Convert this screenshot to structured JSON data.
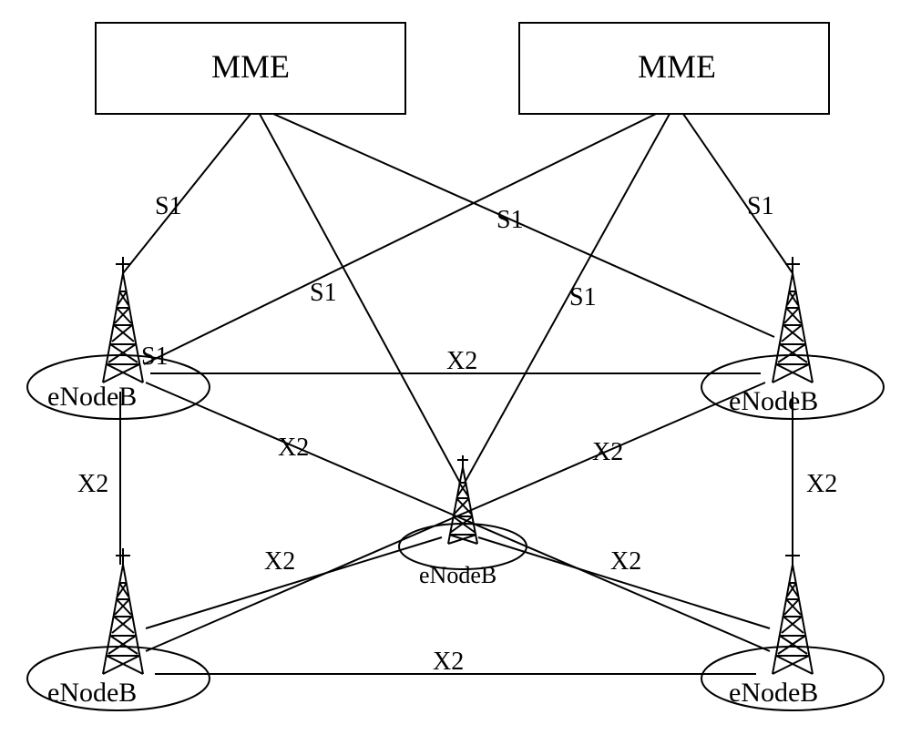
{
  "nodes": {
    "mme1": {
      "label": "MME"
    },
    "mme2": {
      "label": "MME"
    },
    "tower1": {
      "label": "eNodeB"
    },
    "tower2": {
      "label": "eNodeB"
    },
    "tower3": {
      "label": "eNodeB"
    },
    "tower4": {
      "label": "eNodeB"
    },
    "tower5": {
      "label": "eNodeB"
    }
  },
  "edges": {
    "s1_1": {
      "label": "S1"
    },
    "s1_2": {
      "label": "S1"
    },
    "s1_3": {
      "label": "S1"
    },
    "s1_4": {
      "label": "S1"
    },
    "s1_5": {
      "label": "S1"
    },
    "s1_6": {
      "label": "S1"
    },
    "x2_1": {
      "label": "X2"
    },
    "x2_2": {
      "label": "X2"
    },
    "x2_3": {
      "label": "X2"
    },
    "x2_4": {
      "label": "X2"
    },
    "x2_5": {
      "label": "X2"
    },
    "x2_6": {
      "label": "X2"
    },
    "x2_7": {
      "label": "X2"
    },
    "x2_8": {
      "label": "X2"
    }
  }
}
